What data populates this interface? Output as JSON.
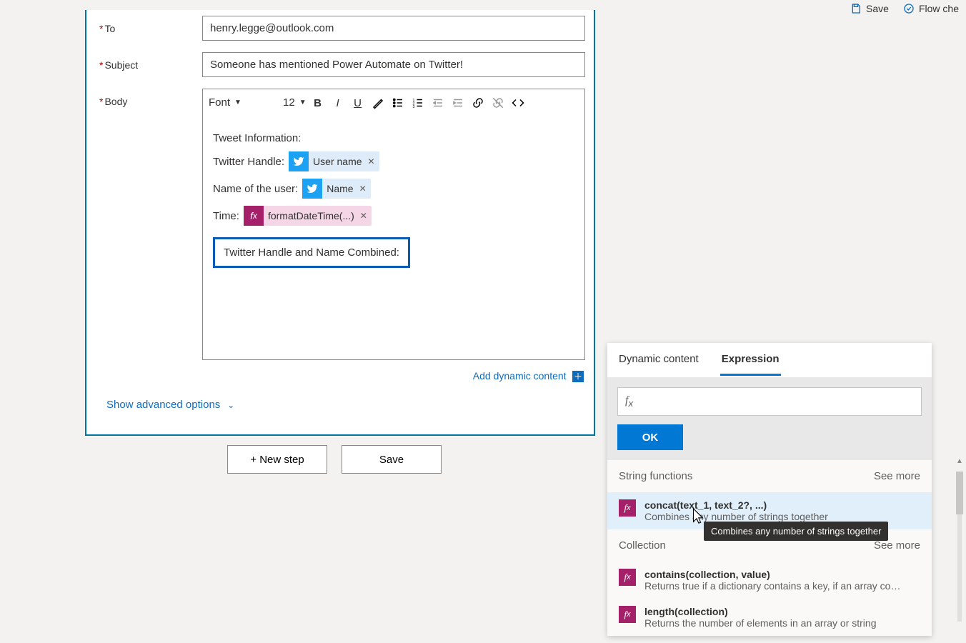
{
  "topbar": {
    "save": "Save",
    "flow_checker": "Flow che"
  },
  "form": {
    "to_label": "To",
    "to_value": "henry.legge@outlook.com",
    "subject_label": "Subject",
    "subject_value": "Someone has mentioned Power Automate on Twitter!",
    "body_label": "Body",
    "font_label": "Font",
    "font_size": "12",
    "body": {
      "line_info": "Tweet Information:",
      "line_handle": "Twitter Handle:",
      "token_user_name": "User name",
      "line_name": "Name of the user:",
      "token_name": "Name",
      "line_time": "Time:",
      "token_fdt": "formatDateTime(...)",
      "line_combined": "Twitter Handle and Name Combined:"
    },
    "add_dynamic": "Add dynamic content",
    "show_advanced": "Show advanced options"
  },
  "footer": {
    "new_step": "+ New step",
    "save": "Save"
  },
  "panel": {
    "tab_dyn": "Dynamic content",
    "tab_exp": "Expression",
    "ok": "OK",
    "groups": [
      {
        "title": "String functions",
        "see_more": "See more",
        "items": [
          {
            "name": "concat(text_1, text_2?, ...)",
            "desc": "Combines any number of strings together"
          }
        ]
      },
      {
        "title": "Collection",
        "see_more": "See more",
        "items": [
          {
            "name": "contains(collection, value)",
            "desc": "Returns true if a dictionary contains a key, if an array cont..."
          },
          {
            "name": "length(collection)",
            "desc": "Returns the number of elements in an array or string"
          }
        ]
      }
    ],
    "tooltip": "Combines any number of strings together"
  }
}
